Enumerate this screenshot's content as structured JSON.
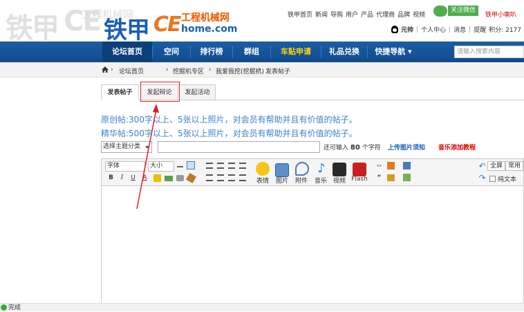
{
  "watermark": {
    "big": "铁甲",
    "letters": "CE",
    "small": "工程机械网"
  },
  "logo": {
    "main": "铁甲",
    "ce": "CE",
    "cn": "工程机械网",
    "url": "home.com"
  },
  "top_links": [
    "铁甲首页",
    "新闻",
    "导购",
    "用户",
    "产品",
    "代理商",
    "品牌",
    "视频"
  ],
  "follow_label": "关注微信",
  "top_user_link": "铁甲小喇叭",
  "user": {
    "name": "元帅",
    "center": "个人中心",
    "message": "消息",
    "remind": "提醒",
    "points": "积分: 2177"
  },
  "nav": {
    "items": [
      "论坛首页",
      "空间",
      "排行榜",
      "群组",
      "车贴申请",
      "礼品兑换",
      "快捷导航"
    ],
    "search_placeholder": "请输入搜索内容"
  },
  "breadcrumb": [
    "论坛首页",
    "挖掘机专区",
    "我爱我挖(挖掘机)",
    "发表帖子"
  ],
  "tabs": [
    "发表帖子",
    "发起辩论",
    "发起活动"
  ],
  "notices": [
    "原创帖:300字以上、5张以上照片，对会员有帮助并且有价值的帖子。",
    "精华帖:500字以上、5张以上照片，对会员有帮助并且有价值的帖子。"
  ],
  "form": {
    "category_placeholder": "选择主题分类",
    "remain_prefix": "还可输入",
    "remain_count": "80",
    "remain_suffix": "个字符",
    "upload_link": "上传图片须知",
    "music_link": "音乐添加教程"
  },
  "toolbar": {
    "font_label": "字体",
    "size_label": "大小",
    "bold": "B",
    "italic": "I",
    "underline": "U",
    "font_color": "A",
    "big_buttons": [
      "表情",
      "图片",
      "附件",
      "音乐",
      "视频",
      "Flash"
    ],
    "fullscreen": "全屏",
    "common": "常用",
    "plain_text": "纯文本"
  },
  "status": "完成"
}
